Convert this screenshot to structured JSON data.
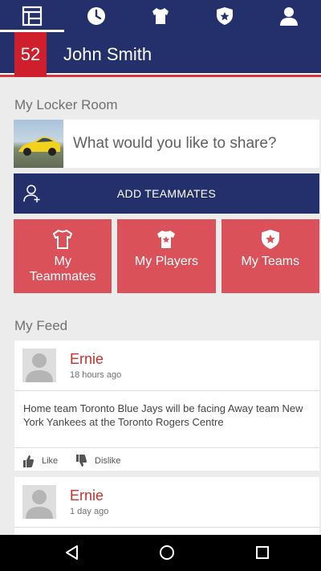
{
  "tabs": [
    {
      "icon": "dashboard-icon",
      "active": true
    },
    {
      "icon": "clock-icon",
      "active": false
    },
    {
      "icon": "jersey-icon",
      "active": false
    },
    {
      "icon": "shield-star-icon",
      "active": false
    },
    {
      "icon": "profile-icon",
      "active": false
    }
  ],
  "header": {
    "jersey_number": "52",
    "user_name": "John Smith"
  },
  "locker_room": {
    "title": "My Locker Room",
    "share_placeholder": "What would you like to share?",
    "add_teammates_label": "ADD TEAMMATES",
    "tiles": [
      {
        "label": "My Teammates",
        "icon": "shirt-icon"
      },
      {
        "label": "My Players",
        "icon": "jersey-star-icon"
      },
      {
        "label": "My Teams",
        "icon": "shield-star-icon"
      }
    ]
  },
  "feed": {
    "title": "My Feed",
    "posts": [
      {
        "author": "Ernie",
        "time": "18 hours ago",
        "body": "Home team Toronto Blue Jays will be facing Away team New York Yankees at the Toronto Rogers Centre",
        "like_label": "Like",
        "dislike_label": "Dislike"
      },
      {
        "author": "Ernie",
        "time": "1 day ago"
      }
    ]
  },
  "colors": {
    "navy": "#23306b",
    "red": "#d01f2c",
    "tile": "#db5159",
    "author": "#c9302c"
  }
}
